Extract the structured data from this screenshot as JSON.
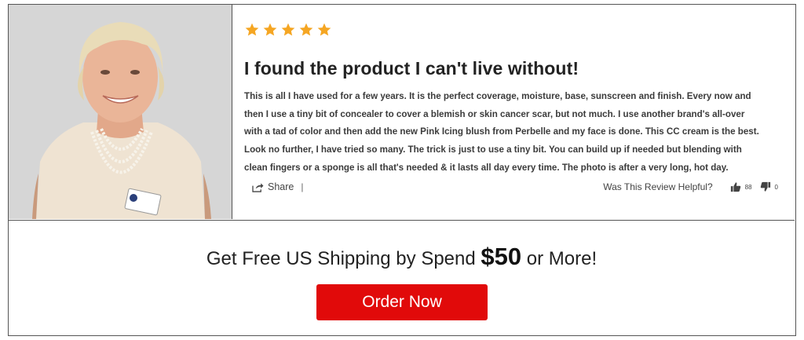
{
  "review": {
    "rating": 5,
    "rating_max": 5,
    "star_color": "#f5a623",
    "title": "I found the product I can't live without!",
    "text": "This is all I have used for a few years. It is the perfect coverage, moisture, base, sunscreen and finish. Every now and then I use a tiny bit of concealer to cover a blemish or skin cancer scar, but not much. I use another brand's all-over with a tad of color and then add the new Pink Icing blush from Perbelle and my face is done. This CC cream is the best. Look no further, I have tried so many. The trick is just to use a tiny bit. You can build up if needed but blending with clean fingers or a sponge is all that's needed & it lasts all day every time. The photo is after a very long, hot day.",
    "share_label": "Share",
    "divider": "|",
    "helpful_question": "Was This Review Helpful?",
    "thumbs_up_count": "88",
    "thumbs_down_count": "0",
    "photo_icon": "reviewer-photo"
  },
  "promo": {
    "text_before": "Get Free US Shipping by Spend ",
    "amount": "$50",
    "text_after": " or More!",
    "button_label": "Order Now",
    "button_color": "#e10a0a"
  }
}
